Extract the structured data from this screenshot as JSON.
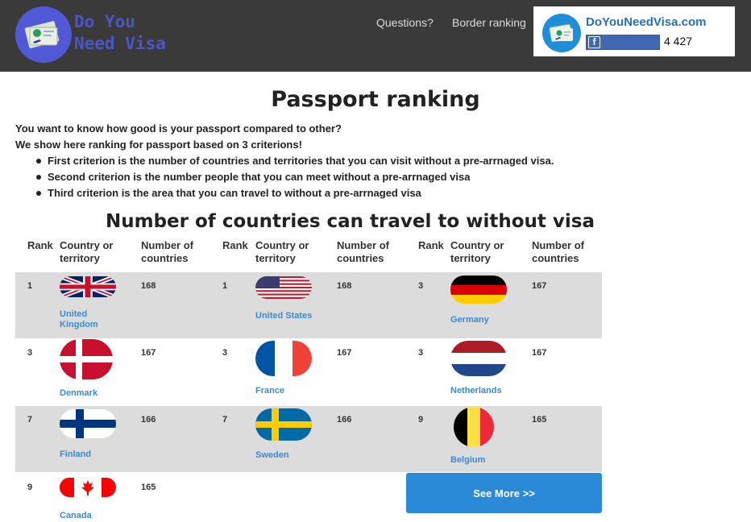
{
  "header": {
    "logo_line1": "Do You",
    "logo_line2": "Need Visa",
    "nav": [
      {
        "label": "Questions?"
      },
      {
        "label": "Border ranking"
      }
    ],
    "fb": {
      "site": "DoYouNeedVisa.com",
      "count": "4 427"
    }
  },
  "page": {
    "title": "Passport ranking",
    "intro1": "You want to know how good is your passport compared to other?",
    "intro2": "We show here ranking for passport based on 3 criterions!",
    "criteria": [
      "First criterion is the number of countries and territories that you can visit without a pre-arrnaged visa.",
      "Second criterion is the number people that you can meet without a pre-arrnaged visa",
      "Third criterion is the area that you can travel to without a pre-arrnaged visa"
    ]
  },
  "table": {
    "title": "Number of countries can travel to without visa",
    "headers": {
      "rank": "Rank",
      "country": "Country or territory",
      "number": "Number of countries"
    },
    "entries": [
      {
        "rank": "1",
        "country": "United Kingdom",
        "value": "168",
        "flag": "uk-flag-icon"
      },
      {
        "rank": "1",
        "country": "United States",
        "value": "168",
        "flag": "us-flag-icon"
      },
      {
        "rank": "3",
        "country": "Germany",
        "value": "167",
        "flag": "germany-flag-icon"
      },
      {
        "rank": "3",
        "country": "Denmark",
        "value": "167",
        "flag": "denmark-flag-icon"
      },
      {
        "rank": "3",
        "country": "France",
        "value": "167",
        "flag": "france-flag-icon"
      },
      {
        "rank": "3",
        "country": "Netherlands",
        "value": "167",
        "flag": "netherlands-flag-icon"
      },
      {
        "rank": "7",
        "country": "Finland",
        "value": "166",
        "flag": "finland-flag-icon"
      },
      {
        "rank": "7",
        "country": "Sweden",
        "value": "166",
        "flag": "sweden-flag-icon"
      },
      {
        "rank": "9",
        "country": "Belgium",
        "value": "165",
        "flag": "belgium-flag-icon"
      },
      {
        "rank": "9",
        "country": "Canada",
        "value": "165",
        "flag": "canada-flag-icon"
      }
    ],
    "see_more": "See More >>"
  },
  "colors": {
    "header_bg": "#3a3a3a",
    "accent_blue": "#2b8ad8",
    "link_blue": "#3a8ad3",
    "row_grey": "#dcdcdc"
  }
}
